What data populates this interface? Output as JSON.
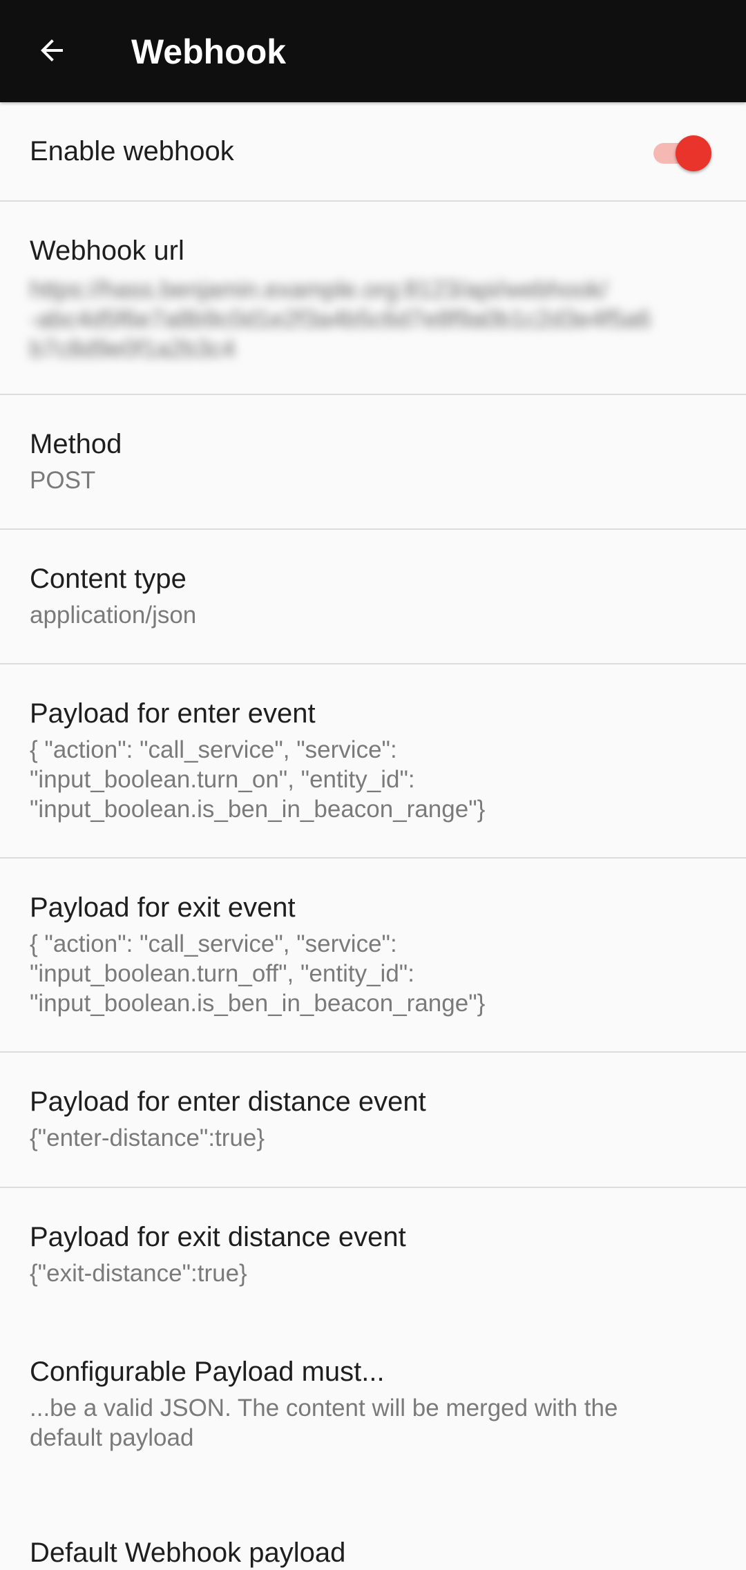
{
  "app_bar": {
    "title": "Webhook",
    "back_icon": "arrow-left-icon"
  },
  "colors": {
    "app_bar_bg": "#0f0f0f",
    "accent": "#e8342a",
    "accent_track": "#f5b8b3"
  },
  "preferences": [
    {
      "id": "enable-webhook",
      "title": "Enable webhook",
      "summary": "",
      "switch_on": true
    },
    {
      "id": "webhook-url",
      "title": "Webhook url",
      "summary": "https://hass.benjamin.example.org:8123/api/webhook/\n-abc4d5f6e7a8b9c0d1e2f3a4b5c6d7e8f9a0b1c2d3e4f5a6\nb7c8d9e0f1a2b3c4"
    },
    {
      "id": "method",
      "title": "Method",
      "summary": "POST"
    },
    {
      "id": "content-type",
      "title": "Content type",
      "summary": "application/json"
    },
    {
      "id": "payload-enter-event",
      "title": "Payload for enter event",
      "summary": "{ \"action\": \"call_service\", \"service\":\n\"input_boolean.turn_on\", \"entity_id\":\n\"input_boolean.is_ben_in_beacon_range\"}"
    },
    {
      "id": "payload-exit-event",
      "title": "Payload for exit event",
      "summary": "{ \"action\": \"call_service\", \"service\":\n\"input_boolean.turn_off\", \"entity_id\":\n\"input_boolean.is_ben_in_beacon_range\"}"
    },
    {
      "id": "payload-enter-distance",
      "title": "Payload for enter distance event",
      "summary": "{\"enter-distance\":true}"
    },
    {
      "id": "payload-exit-distance",
      "title": "Payload for exit distance event",
      "summary": "{\"exit-distance\":true}"
    },
    {
      "id": "configurable-payload-info",
      "title": "Configurable Payload must...",
      "summary": "...be a valid JSON. The content will be merged with the\ndefault payload"
    },
    {
      "id": "default-webhook-payload",
      "title": "Default Webhook payload",
      "summary": ""
    }
  ]
}
